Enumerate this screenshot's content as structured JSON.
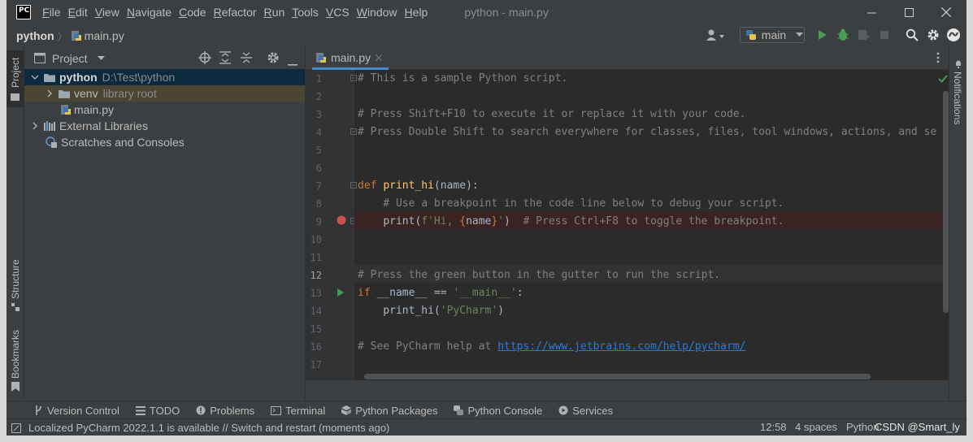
{
  "titlebar": {
    "logo": "PC",
    "menu": [
      {
        "u": "F",
        "rest": "ile"
      },
      {
        "u": "E",
        "rest": "dit"
      },
      {
        "u": "V",
        "rest": "iew"
      },
      {
        "u": "N",
        "rest": "avigate"
      },
      {
        "u": "C",
        "rest": "ode"
      },
      {
        "u": "R",
        "rest": "efactor"
      },
      {
        "u": "R",
        "rest": "un"
      },
      {
        "u": "T",
        "rest": "ools"
      },
      {
        "u": "V",
        "rest": "CS"
      },
      {
        "u": "W",
        "rest": "indow"
      },
      {
        "u": "H",
        "rest": "elp"
      }
    ],
    "window_title": "python - main.py"
  },
  "navbar": {
    "project": "python",
    "file": "main.py",
    "run_config": "main"
  },
  "left_strip": {
    "project_tab": "Project",
    "structure_tab": "Structure",
    "bookmarks_tab": "Bookmarks"
  },
  "right_strip": {
    "notifications_tab": "Notifications"
  },
  "project_panel": {
    "title": "Project",
    "root_name": "python",
    "root_path": "D:\\Test\\python",
    "venv_name": "venv",
    "venv_hint": "library root",
    "file_name": "main.py",
    "external_libraries": "External Libraries",
    "scratches": "Scratches and Consoles"
  },
  "editor": {
    "tab_label": "main.py",
    "line_numbers": [
      "1",
      "2",
      "3",
      "4",
      "5",
      "6",
      "7",
      "8",
      "9",
      "10",
      "11",
      "12",
      "13",
      "14",
      "15",
      "16",
      "17"
    ],
    "code": {
      "l1": "# This is a sample Python script.",
      "l3": "# Press Shift+F10 to execute it or replace it with your code.",
      "l4": "# Press Double Shift to search everywhere for classes, files, tool windows, actions, and se",
      "l7_kw": "def",
      "l7_fn": "print_hi",
      "l7_rest": "(name):",
      "l8": "    # Use a breakpoint in the code line below to debug your script.",
      "l9_indent": "    ",
      "l9_call": "print(",
      "l9_str1": "f'Hi, ",
      "l9_brace1": "{",
      "l9_var": "name",
      "l9_brace2": "}",
      "l9_str2": "'",
      "l9_close": ")  ",
      "l9_cmt": "# Press Ctrl+F8 to toggle the breakpoint.",
      "l12": "# Press the green button in the gutter to run the script.",
      "l13_kw": "if",
      "l13_mid": " __name__ == ",
      "l13_str": "'__main__'",
      "l13_end": ":",
      "l14_call": "    print_hi(",
      "l14_str": "'PyCharm'",
      "l14_end": ")",
      "l16_cmt": "# See PyCharm help at ",
      "l16_link": "https://www.jetbrains.com/help/pycharm/"
    }
  },
  "bottom_tools": [
    {
      "name": "Version Control",
      "icon": "branch-icon"
    },
    {
      "name": "TODO",
      "icon": "list-icon"
    },
    {
      "name": "Problems",
      "icon": "problems-icon"
    },
    {
      "name": "Terminal",
      "icon": "terminal-icon"
    },
    {
      "name": "Python Packages",
      "icon": "packages-icon"
    },
    {
      "name": "Python Console",
      "icon": "python-icon"
    },
    {
      "name": "Services",
      "icon": "services-icon"
    }
  ],
  "statusbar": {
    "message": "Localized PyCharm 2022.1.1 is available // Switch and restart (moments ago)",
    "position": "12:58",
    "indent": "4 spaces",
    "interpreter": "Python",
    "watermark": "CSDN @Smart_ly"
  },
  "colors": {
    "accent": "#4a88c7",
    "run_green": "#499c54",
    "breakpoint_red": "#c75450",
    "background": "#2b2b2b"
  }
}
